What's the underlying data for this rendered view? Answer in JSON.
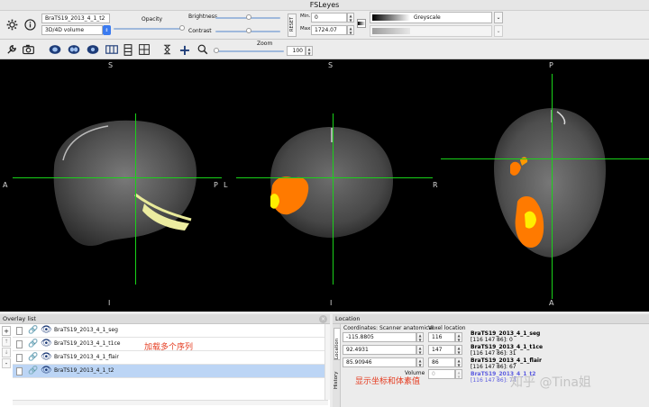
{
  "window": {
    "title": "FSLeyes"
  },
  "toolbar": {
    "overlay_name": "BraTS19_2013_4_1_t2",
    "overlay_type": "3D/4D volume",
    "opacity_label": "Opacity",
    "brightness_label": "Brightness",
    "contrast_label": "Contrast",
    "reset_label": "RESET",
    "min_label": "Min.",
    "min_value": "0",
    "max_label": "Max.",
    "max_value": "1724.07",
    "colormap": "Greyscale",
    "zoom_label": "Zoom",
    "zoom_value": "100"
  },
  "views": {
    "sagittal": {
      "top": "S",
      "bottom": "I",
      "left": "A",
      "right": "P"
    },
    "coronal": {
      "top": "S",
      "bottom": "I",
      "left": "L",
      "right": "R"
    },
    "axial": {
      "top": "P",
      "bottom": "A",
      "left": "",
      "right": ""
    }
  },
  "overlay_list": {
    "title": "Overlay list",
    "buttons": [
      "+",
      "↑",
      "↓",
      "-"
    ],
    "items": [
      {
        "name": "BraTS19_2013_4_1_seg"
      },
      {
        "name": "BraTS19_2013_4_1_t1ce"
      },
      {
        "name": "BraTS19_2013_4_1_flair"
      },
      {
        "name": "BraTS19_2013_4_1_t2"
      }
    ],
    "annotation": "加载多个序列"
  },
  "location": {
    "title": "Location",
    "side_tab_location": "Location",
    "side_tab_history": "History",
    "coords_label": "Coordinates: Scanner anatomical",
    "voxel_label": "Voxel location",
    "coords": [
      "-115.8805",
      "92.4931",
      "85.90946"
    ],
    "voxels": [
      "116",
      "147",
      "86"
    ],
    "volume_label": "Volume",
    "volume_value": "0",
    "annotation": "显示坐标和体素值",
    "info": [
      {
        "name": "BraTS19_2013_4_1_seg",
        "value": "[116 147 86]: 0",
        "color": "#000000"
      },
      {
        "name": "BraTS19_2013_4_1_t1ce",
        "value": "[116 147 86]: 31",
        "color": "#000000"
      },
      {
        "name": "BraTS19_2013_4_1_flair",
        "value": "[116 147 86]: 67",
        "color": "#000000"
      },
      {
        "name": "BraTS19_2013_4_1_t2",
        "value": "[116 147 86]: 74",
        "color": "#5a5ae0"
      }
    ],
    "watermark": "知乎 @Tina姐"
  },
  "colors": {
    "crosshair": "#19d219",
    "tumor_orange": "#ff7a00",
    "tumor_yellow": "#ffee00",
    "selection": "#bcd5f5"
  }
}
